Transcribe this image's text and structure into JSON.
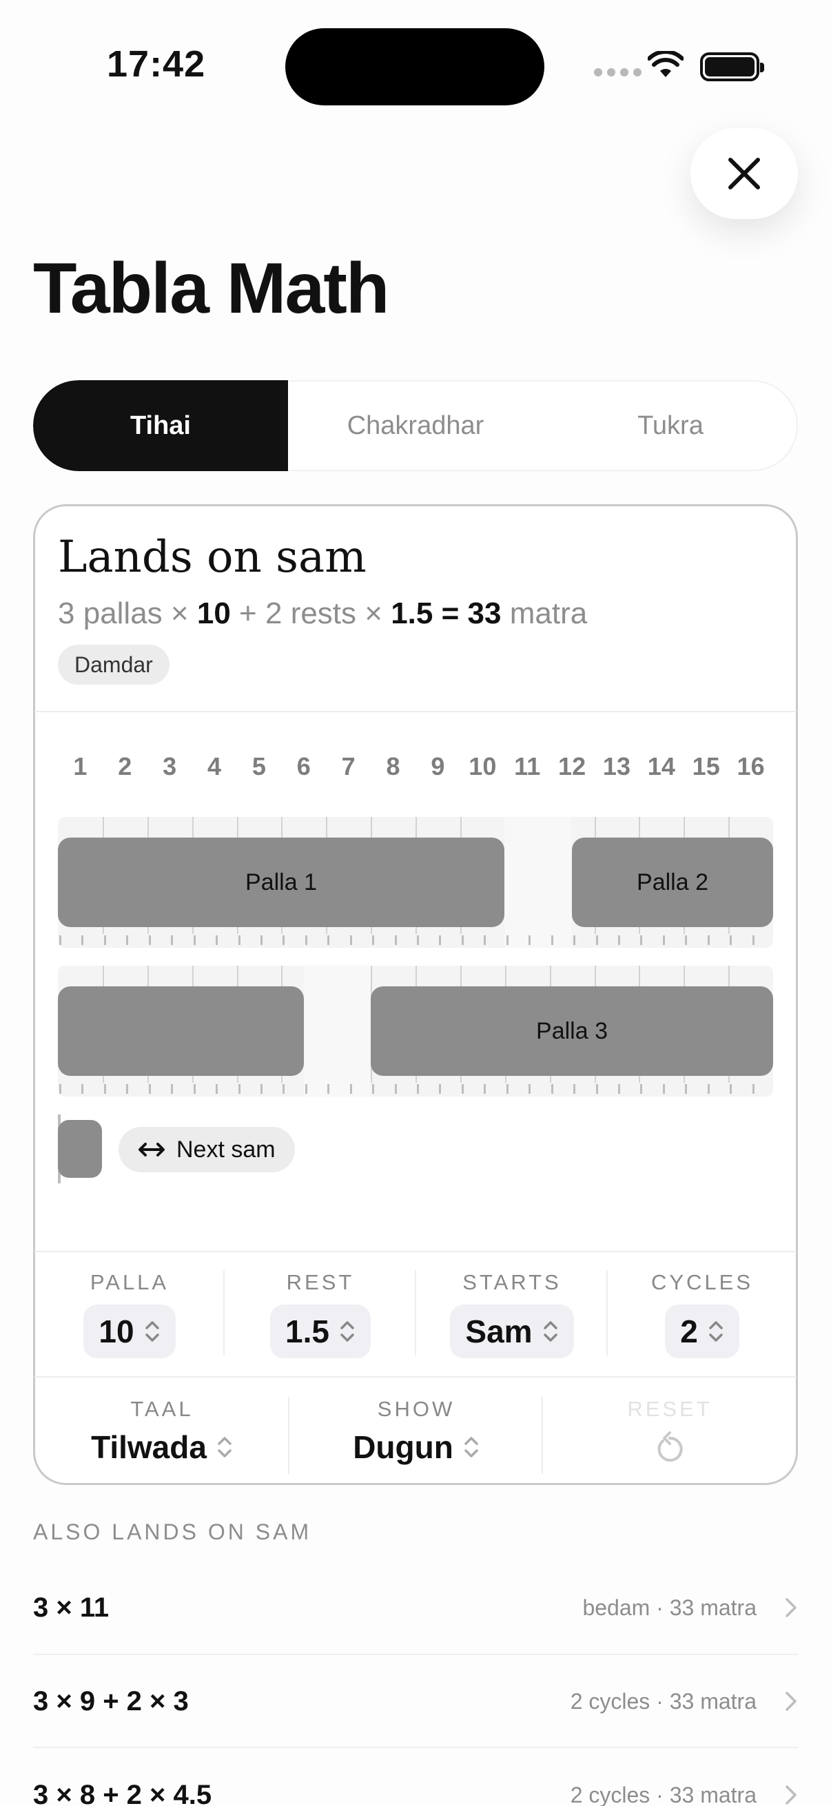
{
  "status": {
    "time": "17:42"
  },
  "page_title": "Tabla Math",
  "tabs": [
    {
      "label": "Tihai",
      "active": true
    },
    {
      "label": "Chakradhar",
      "active": false
    },
    {
      "label": "Tukra",
      "active": false
    }
  ],
  "result": {
    "title": "Lands on sam",
    "formula": {
      "count": "3",
      "pallas_text": "pallas ×",
      "palla_len": "10",
      "plus": "+",
      "rests_count": "2",
      "rests_text": "rests ×",
      "rest_len": "1.5",
      "equals": "= 33",
      "unit": "matra"
    },
    "badge": "Damdar"
  },
  "beats": [
    "1",
    "2",
    "3",
    "4",
    "5",
    "6",
    "7",
    "8",
    "9",
    "10",
    "11",
    "12",
    "13",
    "14",
    "15",
    "16"
  ],
  "pallas": {
    "p1": "Palla 1",
    "p2": "Palla 2",
    "p3": "Palla 3"
  },
  "next_sam": {
    "icon": "left-right-arrow-icon",
    "label": "Next sam"
  },
  "controls": {
    "palla": {
      "label": "PALLA",
      "value": "10"
    },
    "rest": {
      "label": "REST",
      "value": "1.5"
    },
    "starts": {
      "label": "STARTS",
      "value": "Sam"
    },
    "cycles": {
      "label": "CYCLES",
      "value": "2"
    },
    "taal": {
      "label": "TAAL",
      "value": "Tilwada"
    },
    "show": {
      "label": "SHOW",
      "value": "Dugun"
    },
    "reset": {
      "label": "RESET",
      "icon": "reset-icon"
    }
  },
  "also": {
    "heading": "ALSO LANDS ON SAM",
    "items": [
      {
        "equation": "3 × 11",
        "meta": "bedam · 33 matra"
      },
      {
        "equation": "3 × 9 + 2 × 3",
        "meta": "2 cycles · 33 matra"
      },
      {
        "equation": "3 × 8 + 2 × 4.5",
        "meta": "2 cycles · 33 matra"
      }
    ]
  },
  "colors": {
    "accent": "#111111",
    "palla_fill": "#8c8c8c",
    "muted": "#8d8d8d"
  }
}
